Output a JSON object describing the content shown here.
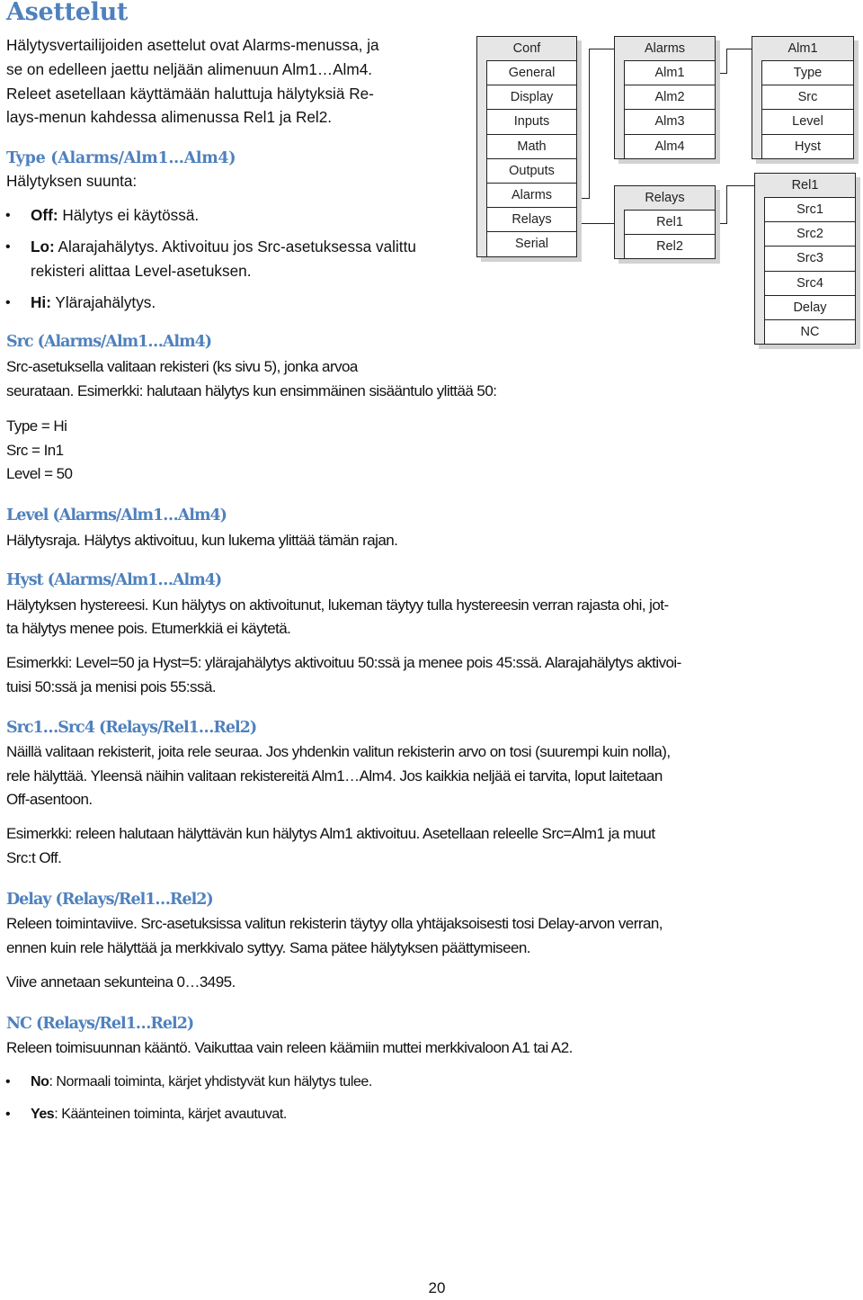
{
  "title": "Asettelut",
  "intro": "Hälytysvertailijoiden asettelut ovat Alarms-menussa, ja se on edelleen jaettu neljään alimenuun Alm1…Alm4. Releet asetellaan käyttämään haluttuja hälytyksiä Relays-menun kahdessa alimenussa Rel1 ja Rel2.",
  "intro_lines": [
    "Hälytysvertailijoiden asettelut ovat Alarms-menussa, ja",
    "se on edelleen jaettu neljään alimenuun Alm1…Alm4.",
    "Releet asetellaan käyttämään haluttuja hälytyksiä Re-",
    "lays-menun kahdessa alimenussa Rel1 ja Rel2."
  ],
  "diagram": {
    "menus": [
      {
        "id": "conf",
        "title": "Conf",
        "items": [
          "General",
          "Display",
          "Inputs",
          "Math",
          "Outputs",
          "Alarms",
          "Relays",
          "Serial"
        ]
      },
      {
        "id": "alarms",
        "title": "Alarms",
        "items": [
          "Alm1",
          "Alm2",
          "Alm3",
          "Alm4"
        ]
      },
      {
        "id": "alm1",
        "title": "Alm1",
        "items": [
          "Type",
          "Src",
          "Level",
          "Hyst"
        ]
      },
      {
        "id": "relays",
        "title": "Relays",
        "items": [
          "Rel1",
          "Rel2"
        ]
      },
      {
        "id": "rel1",
        "title": "Rel1",
        "items": [
          "Src1",
          "Src2",
          "Src3",
          "Src4",
          "Delay",
          "NC"
        ]
      }
    ],
    "connections": [
      {
        "from": "Conf/Alarms",
        "to": "Alarms"
      },
      {
        "from": "Alarms/Alm1",
        "to": "Alm1"
      },
      {
        "from": "Conf/Relays",
        "to": "Relays"
      },
      {
        "from": "Relays/Rel1",
        "to": "Rel1"
      }
    ]
  },
  "sections": {
    "type": {
      "heading": "Type (Alarms/Alm1…Alm4)",
      "body": "Hälytyksen suunta:",
      "bullets": [
        {
          "term": "Off:",
          "text": " Hälytys ei käytössä."
        },
        {
          "term": "Lo:",
          "text": " Alarajahälytys. Aktivoituu jos Src-asetuksessa valittu rekisteri alittaa Level-asetuksen."
        },
        {
          "term": "Hi:",
          "text": " Ylärajahälytys."
        }
      ]
    },
    "src": {
      "heading": "Src (Alarms/Alm1…Alm4)",
      "body_lines": [
        "Src-asetuksella valitaan rekisteri (ks sivu 5), jonka arvoa",
        "seurataan. Esimerkki: halutaan hälytys kun ensimmäinen sisääntulo ylittää 50:"
      ],
      "example_lines": [
        "Type = Hi",
        "Src = In1",
        "Level = 50"
      ]
    },
    "level": {
      "heading": "Level (Alarms/Alm1…Alm4)",
      "body": "Hälytysraja. Hälytys aktivoituu, kun lukema ylittää tämän rajan."
    },
    "hyst": {
      "heading": "Hyst (Alarms/Alm1…Alm4)",
      "body_lines": [
        "Hälytyksen hystereesi. Kun hälytys on aktivoitunut, lukeman täytyy tulla hystereesin verran rajasta ohi, jot-",
        "ta hälytys menee pois. Etumerkkiä ei käytetä."
      ],
      "example_lines": [
        "Esimerkki: Level=50 ja Hyst=5: ylärajahälytys aktivoituu 50:ssä ja menee pois 45:ssä. Alarajahälytys aktivoi-",
        "tuisi 50:ssä ja menisi pois 55:ssä."
      ]
    },
    "srcrel": {
      "heading": "Src1…Src4 (Relays/Rel1…Rel2)",
      "body_lines": [
        "Näillä valitaan rekisterit, joita rele seuraa. Jos yhdenkin valitun rekisterin arvo on tosi (suurempi kuin nolla),",
        "rele hälyttää. Yleensä näihin valitaan rekistereitä Alm1…Alm4. Jos kaikkia neljää ei tarvita, loput laitetaan",
        "Off-asentoon."
      ],
      "example_lines": [
        "Esimerkki: releen halutaan hälyttävän kun hälytys Alm1 aktivoituu. Asetellaan releelle Src=Alm1 ja muut",
        "Src:t Off."
      ]
    },
    "delay": {
      "heading": "Delay (Relays/Rel1…Rel2)",
      "body_lines": [
        "Releen toimintaviive. Src-asetuksissa valitun rekisterin täytyy olla yhtäjaksoisesti tosi Delay-arvon verran,",
        "ennen kuin rele hälyttää ja merkkivalo syttyy. Sama pätee hälytyksen päättymiseen."
      ],
      "note": "Viive annetaan sekunteina 0…3495."
    },
    "nc": {
      "heading": "NC (Relays/Rel1…Rel2)",
      "body": "Releen toimisuunnan kääntö. Vaikuttaa vain releen käämiin muttei merkkivaloon A1 tai A2.",
      "bullets": [
        {
          "term": "No",
          "text": ": Normaali toiminta, kärjet yhdistyvät kun hälytys tulee."
        },
        {
          "term": "Yes",
          "text": ": Käänteinen toiminta, kärjet avautuvat."
        }
      ]
    }
  },
  "page_number": "20",
  "colors": {
    "heading": "#4f81bd",
    "text": "#111111",
    "box_header": "#e6e6e6",
    "box_border": "#222222"
  }
}
